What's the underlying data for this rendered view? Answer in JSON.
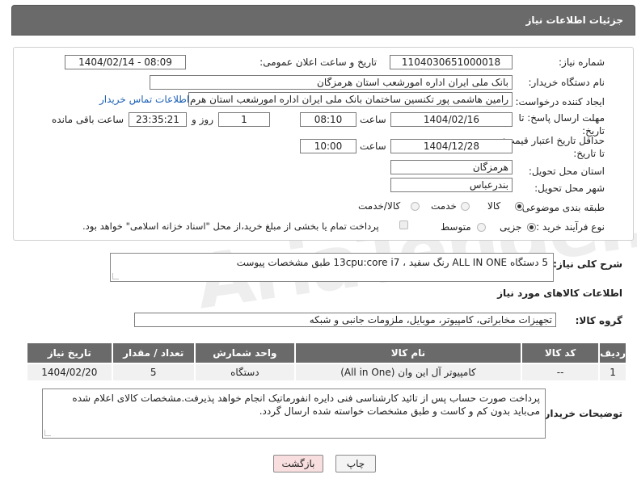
{
  "header": {
    "title": "جزئیات اطلاعات نیاز"
  },
  "form": {
    "need_number": {
      "label": "شماره نیاز:",
      "value": "1104030651000018"
    },
    "announce": {
      "label": "تاریخ و ساعت اعلان عمومی:",
      "value": "1404/02/14 - 08:09"
    },
    "buyer_org": {
      "label": "نام دستگاه خریدار:",
      "value": "بانک ملی ایران اداره امورشعب استان هرمزگان"
    },
    "creator": {
      "label": "ایجاد کننده درخواست:",
      "value": "رامین هاشمی پور تکنسین ساختمان بانک ملی ایران اداره امورشعب استان هرم",
      "contact_link": "اطلاعات تماس خریدار"
    },
    "reply_deadline": {
      "label": "مهلت ارسال پاسخ: تا تاریخ:",
      "date": "1404/02/16",
      "time_label": "ساعت",
      "time": "08:10",
      "days": "1",
      "days_label": "روز و",
      "remaining": "23:35:21",
      "remaining_label": "ساعت باقی مانده"
    },
    "price_validity": {
      "label": "حداقل تاریخ اعتبار قیمت: تا تاریخ:",
      "date": "1404/12/28",
      "time_label": "ساعت",
      "time": "10:00"
    },
    "province": {
      "label": "استان محل تحویل:",
      "value": "هرمزگان"
    },
    "city": {
      "label": "شهر محل تحویل:",
      "value": "بندرعباس"
    },
    "category": {
      "label": "طبقه بندی موضوعی:",
      "options": [
        "کالا",
        "خدمت",
        "کالا/خدمت"
      ],
      "selected": "کالا"
    },
    "process": {
      "label": "نوع فرآیند خرید :",
      "options": [
        "جزیی",
        "متوسط"
      ],
      "selected": "جزیی",
      "note": "پرداخت تمام یا بخشی از مبلغ خرید،از محل \"اسناد خزانه اسلامی\" خواهد بود."
    }
  },
  "description": {
    "label": "شرح کلی نیاز:",
    "value": "5 دستگاه ALL IN ONE رنگ سفید ، 13cpu:core i7 طبق مشخصات پیوست"
  },
  "goods_info": {
    "title": "اطلاعات کالاهای مورد نیاز"
  },
  "goods_group": {
    "label": "گروه کالا:",
    "value": "تجهیزات مخابراتی، کامپیوتر، موبایل، ملزومات جانبی و شبکه"
  },
  "table": {
    "headers": [
      "ردیف",
      "کد کالا",
      "نام کالا",
      "واحد شمارش",
      "تعداد / مقدار",
      "تاریخ نیاز"
    ],
    "rows": [
      [
        "1",
        "--",
        "کامپیوتر آل این وان (All in One)",
        "دستگاه",
        "5",
        "1404/02/20"
      ]
    ]
  },
  "buyer_notes": {
    "label": "توضیحات خریدار:",
    "value": "پرداخت صورت حساب پس از تائید کارشناسی فنی دایره انفورماتیک انجام خواهد پذیرفت.مشخصات کالای اعلام شده می‌باید بدون کم و کاست و طبق مشخصات خواسته شده ارسال گردد."
  },
  "buttons": {
    "print": "چاپ",
    "back": "بازگشت"
  },
  "watermark": "AriaTender.neT",
  "colors": {
    "header_bg": "#6a6a6a",
    "link": "#1a5fb4",
    "back_bg": "#f8dede"
  }
}
